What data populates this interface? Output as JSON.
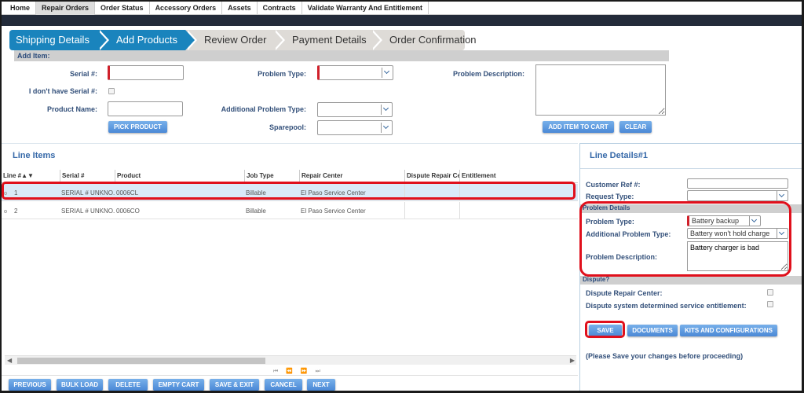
{
  "nav": {
    "tabs": [
      "Home",
      "Repair Orders",
      "Order Status",
      "Accessory Orders",
      "Assets",
      "Contracts",
      "Validate Warranty And Entitlement"
    ],
    "active_tab": "Repair Orders"
  },
  "wizard": {
    "steps": [
      {
        "label": "Shipping Details",
        "state": "done"
      },
      {
        "label": "Add Products",
        "state": "current"
      },
      {
        "label": "Review Order",
        "state": "todo"
      },
      {
        "label": "Payment Details",
        "state": "todo"
      },
      {
        "label": "Order Confirmation",
        "state": "todo"
      }
    ]
  },
  "add_item": {
    "title": "Add Item:",
    "serial_label": "Serial #:",
    "serial_value": "",
    "no_serial_label": "I don't have Serial #:",
    "product_name_label": "Product Name:",
    "product_name_value": "",
    "pick_product_button": "PICK PRODUCT",
    "problem_type_label": "Problem Type:",
    "problem_type_value": "",
    "additional_problem_type_label": "Additional Problem Type:",
    "additional_problem_type_value": "",
    "sparepool_label": "Sparepool:",
    "sparepool_value": "",
    "problem_description_label": "Problem Description:",
    "problem_description_value": "",
    "add_to_cart_button": "ADD ITEM TO CART",
    "clear_button": "CLEAR"
  },
  "line_items": {
    "title": "Line Items",
    "columns": [
      "Line #▲▼",
      "Serial #",
      "Product",
      "Job Type",
      "Repair Center",
      "Dispute Repair Center",
      "Entitlement"
    ],
    "rows": [
      {
        "line": "1",
        "serial": "SERIAL # UNKNO...",
        "product": "0006CL",
        "job_type": "Billable",
        "repair_center": "El Paso Service Center",
        "dispute_repair_center": "",
        "entitlement": "",
        "selected": true
      },
      {
        "line": "2",
        "serial": "SERIAL # UNKNO...",
        "product": "0006CO",
        "job_type": "Billable",
        "repair_center": "El Paso Service Center",
        "dispute_repair_center": "",
        "entitlement": "",
        "selected": false
      }
    ],
    "pager": "⏮ ⏪ ⏩ ⏭"
  },
  "bottom_buttons": [
    "PREVIOUS",
    "BULK LOAD",
    "DELETE",
    "EMPTY CART",
    "SAVE & EXIT",
    "CANCEL",
    "NEXT"
  ],
  "line_details": {
    "title": "Line Details#1",
    "customer_ref_label": "Customer Ref #:",
    "customer_ref_value": "",
    "request_type_label": "Request Type:",
    "request_type_value": "",
    "problem_details_header": "Problem Details",
    "problem_type_label": "Problem Type:",
    "problem_type_value": "Battery backup",
    "additional_problem_type_label": "Additional Problem Type:",
    "additional_problem_type_value": "Battery won't hold charge",
    "problem_description_label": "Problem Description:",
    "problem_description_value": "Battery charger is bad",
    "dispute_header": "Dispute?",
    "dispute_repair_center_label": "Dispute Repair Center:",
    "dispute_entitlement_label": "Dispute system determined service entitlement:",
    "save_button": "SAVE",
    "documents_button": "DOCUMENTS",
    "kits_button": "KITS AND CONFIGURATIONS",
    "note": "(Please Save your changes before proceeding)"
  },
  "colors": {
    "step_active": "#1a84bd",
    "step_inactive": "#dedbd7",
    "highlight": "#e0101c",
    "required": "#d0202a",
    "button": "#4a88d6"
  }
}
